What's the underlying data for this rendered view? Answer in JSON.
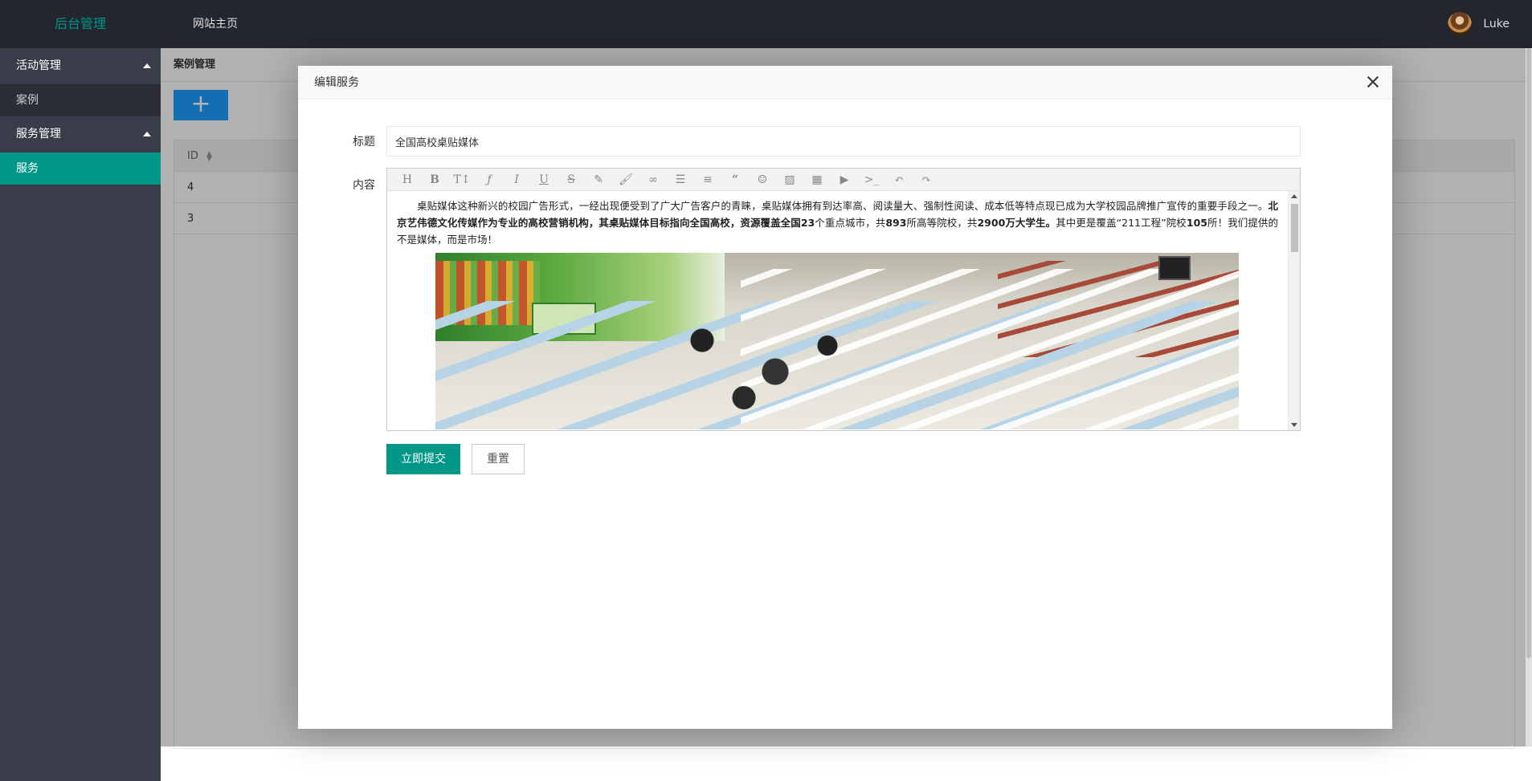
{
  "header": {
    "logo": "后台管理",
    "nav_home": "网站主页",
    "user_name": "Luke"
  },
  "sidebar": {
    "groups": [
      {
        "label": "活动管理",
        "items": [
          {
            "label": "案例",
            "active": false
          }
        ]
      },
      {
        "label": "服务管理",
        "items": [
          {
            "label": "服务",
            "active": true
          }
        ]
      }
    ]
  },
  "main": {
    "breadcrumb": "案例管理",
    "add_label": "+",
    "table": {
      "columns": [
        "ID"
      ],
      "rows": [
        [
          "4"
        ],
        [
          "3"
        ]
      ]
    }
  },
  "modal": {
    "title": "编辑服务",
    "title_label": "标题",
    "title_value": "全国高校桌贴媒体",
    "content_label": "内容",
    "toolbar": [
      "heading-icon",
      "bold-icon",
      "font-size-icon",
      "font-family-icon",
      "italic-icon",
      "underline-icon",
      "strikethrough-icon",
      "forecolor-icon",
      "backcolor-icon",
      "link-icon",
      "list-icon",
      "align-icon",
      "quote-icon",
      "emoticon-icon",
      "image-icon",
      "table-icon",
      "video-icon",
      "code-icon",
      "undo-icon",
      "redo-icon"
    ],
    "content": {
      "p1": "桌贴媒体这种新兴的校园广告形式，一经出现便受到了广大广告客户的青睐，桌贴媒体拥有到达率高、阅读量大、强制性阅读、成本低等特点现已成为大学校园品牌推广宣传的重要手段之一。",
      "p2": "北京艺伟德文化传媒作为专业的高校营销机构，其桌贴媒体目标指向全国高校，资源覆盖全国",
      "n1": "23",
      "p3": "个重点城市，共",
      "n2": "893",
      "p4": "所高等院校，共",
      "n3": "2900",
      "p5": "万大学生。",
      "p6": "其中更是覆盖“211工程”院校",
      "n4": "105",
      "p7": "所！我们提供的不是媒体，而是市场！"
    },
    "submit_label": "立即提交",
    "reset_label": "重置"
  },
  "colors": {
    "accent": "#009688",
    "header_bg": "#23262e",
    "sidebar_bg": "#393d49",
    "add_button": "#1e9fff"
  }
}
